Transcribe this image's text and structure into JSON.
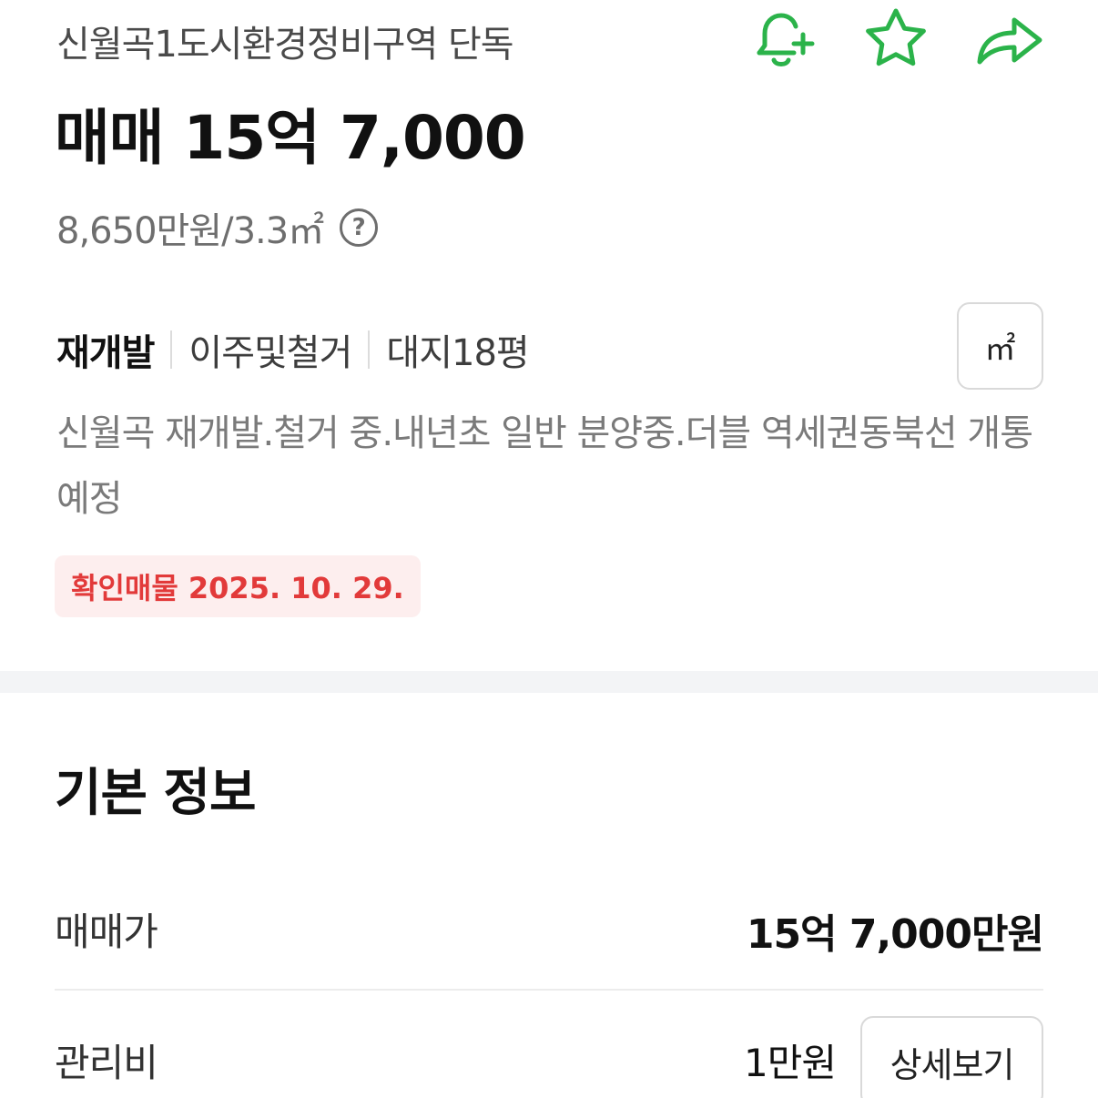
{
  "listing": {
    "title": "신월곡1도시환경정비구역 단독",
    "price": "매매 15억 7,000",
    "unit_price": "8,650만원/3.3㎡",
    "help_symbol": "?"
  },
  "actions": {
    "icons": [
      "bell-plus-icon",
      "star-icon",
      "share-arrow-icon"
    ],
    "accent_color": "#2bb34a"
  },
  "tags": {
    "items": [
      "재개발",
      "이주및철거",
      "대지18평"
    ]
  },
  "unit_toggle": {
    "label": "㎡"
  },
  "description": "신월곡 재개발.철거 중.내년초 일반 분양중.더블 역세권동북선 개통예정",
  "badge": {
    "text": "확인매물 2025. 10. 29.",
    "color": "#e23a3a"
  },
  "basic_info": {
    "title": "기본 정보",
    "rows": [
      {
        "label": "매매가",
        "value": "15억 7,000만원"
      },
      {
        "label": "관리비",
        "value": "1만원",
        "button": "상세보기"
      }
    ]
  }
}
